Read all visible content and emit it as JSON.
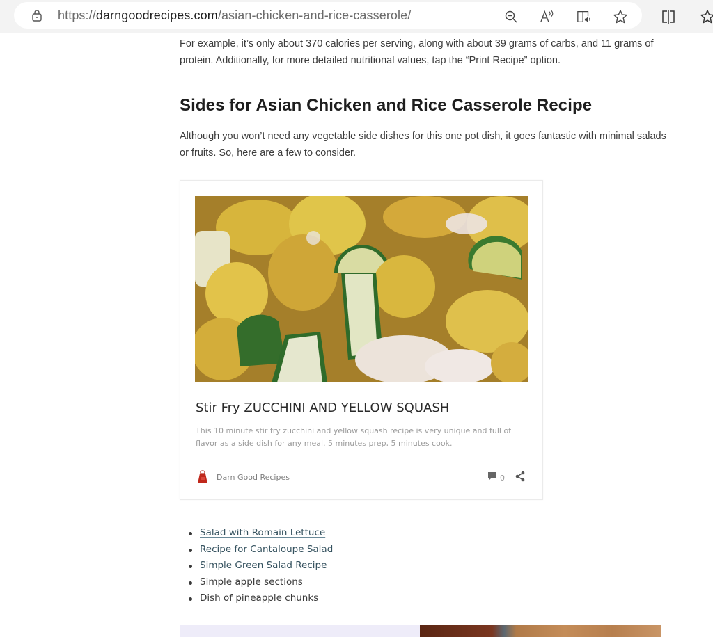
{
  "browser": {
    "url_prefix": "https://",
    "url_domain": "darngoodrecipes.com",
    "url_path": "/asian-chicken-and-rice-casserole/",
    "icons": [
      "lock-icon",
      "zoom-out-icon",
      "read-aloud-icon",
      "immersive-reader-icon",
      "favorite-star-icon",
      "split-screen-icon",
      "favorites-list-icon"
    ]
  },
  "article": {
    "intro_paragraph": "For example, it’s only about 370 calories per serving, along with about 39 grams of carbs, and 11 grams of protein. Additionally, for more detailed nutritional values, tap the “Print Recipe” option.",
    "heading": "Sides for Asian Chicken and Rice Casserole Recipe",
    "sides_paragraph": "Although you won’t need any vegetable side dishes for this one pot dish, it goes fantastic with minimal salads or fruits. So, here are a few to consider."
  },
  "card": {
    "image_alt": "Stir fry zucchini and yellow squash with sesame seeds",
    "title": "Stir Fry ZUCCHINI AND YELLOW SQUASH",
    "description": "This 10 minute stir fry zucchini and yellow squash recipe is very unique and full of flavor as a side dish for any meal. 5 minutes prep, 5 minutes cook.",
    "author": "Darn Good Recipes",
    "comment_count": "0"
  },
  "sides_list": [
    {
      "label": "Salad with Romain Lettuce",
      "link": true
    },
    {
      "label": "Recipe for Cantaloupe Salad",
      "link": true
    },
    {
      "label": "Simple Green Salad Recipe",
      "link": true
    },
    {
      "label": "Simple apple sections",
      "link": false
    },
    {
      "label": "Dish of pineapple chunks",
      "link": false
    }
  ],
  "colors": {
    "link": "#35525f",
    "heading": "#1e1e1e",
    "muted": "#9a9a9a",
    "apron_red": "#c0281b"
  }
}
